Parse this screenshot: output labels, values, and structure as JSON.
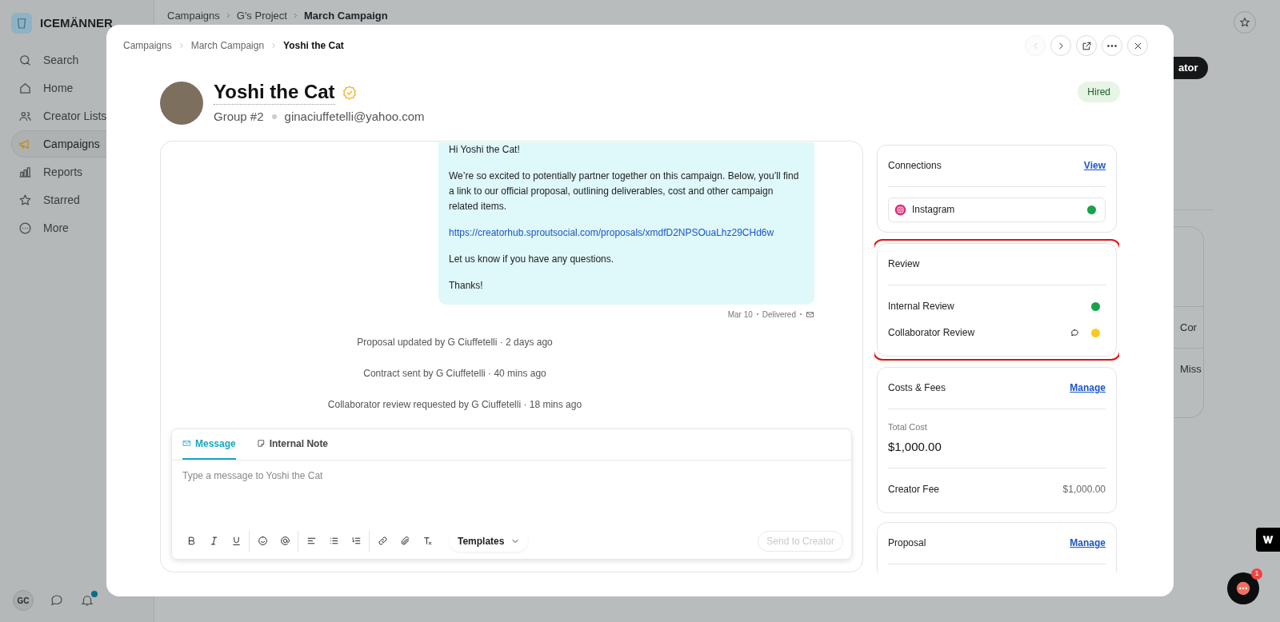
{
  "app": {
    "brand": "ICEMÄNNER",
    "nav": [
      {
        "kind": "search",
        "label": "Search",
        "selected": false
      },
      {
        "kind": "home",
        "label": "Home",
        "selected": false
      },
      {
        "kind": "lists",
        "label": "Creator Lists",
        "selected": false
      },
      {
        "kind": "campaigns",
        "label": "Campaigns",
        "selected": true
      },
      {
        "kind": "reports",
        "label": "Reports",
        "selected": false
      },
      {
        "kind": "starred",
        "label": "Starred",
        "selected": false
      },
      {
        "kind": "more",
        "label": "More",
        "selected": false
      }
    ],
    "user_initials": "GC",
    "notifications_unread": true,
    "breadcrumbs": [
      "Campaigns",
      "G's Project",
      "March Campaign"
    ],
    "partial_button": "ator",
    "partial_texts": [
      "Cor",
      "Miss"
    ],
    "chat_badge": "1"
  },
  "modal": {
    "breadcrumbs": [
      "Campaigns",
      "March Campaign",
      "Yoshi the Cat"
    ],
    "nav_buttons": [
      {
        "kind": "prev",
        "disabled": true
      },
      {
        "kind": "next",
        "disabled": false
      },
      {
        "kind": "open",
        "disabled": false
      },
      {
        "kind": "more",
        "disabled": false
      },
      {
        "kind": "close",
        "disabled": false
      }
    ],
    "creator": {
      "name": "Yoshi the Cat",
      "verified": true,
      "group": "Group #2",
      "email": "ginaciuffetelli@yahoo.com",
      "status": "Hired"
    },
    "message": {
      "paragraphs": [
        {
          "kind": "text",
          "text": "Hi Yoshi the Cat!"
        },
        {
          "kind": "text",
          "text": "We’re so excited to potentially partner together on this campaign. Below, you’ll find a link to our official proposal, outlining deliverables, cost and other campaign related items."
        },
        {
          "kind": "link",
          "text": "https://creatorhub.sproutsocial.com/proposals/xmdfD2NPSOuaLhz29CHd6w"
        },
        {
          "kind": "text",
          "text": "Let us know if you have any questions."
        },
        {
          "kind": "text",
          "text": "Thanks!"
        }
      ],
      "date": "Mar 10",
      "status": "Delivered"
    },
    "events": [
      "Proposal updated by G Ciuffetelli · 2 days ago",
      "Contract sent by G Ciuffetelli · 40 mins ago",
      "Collaborator review requested by G Ciuffetelli · 18 mins ago"
    ],
    "composer": {
      "tabs": [
        {
          "kind": "message",
          "label": "Message",
          "selected": true
        },
        {
          "kind": "note",
          "label": "Internal Note",
          "selected": false
        }
      ],
      "placeholder": "Type a message to Yoshi the Cat",
      "templates": "Templates",
      "send": "Send to Creator",
      "send_disabled": true
    },
    "cards": [
      {
        "kind": "connections",
        "title": "Connections",
        "action": "View",
        "highlighted": false,
        "items": [
          {
            "label": "Instagram",
            "color": "#16a34a"
          }
        ]
      },
      {
        "kind": "review",
        "title": "Review",
        "highlighted": true,
        "items": [
          {
            "label": "Internal Review",
            "color": "#16a34a",
            "comment": false
          },
          {
            "label": "Collaborator Review",
            "color": "#fbc926",
            "comment": true
          }
        ]
      },
      {
        "kind": "costs",
        "title": "Costs & Fees",
        "action": "Manage",
        "highlighted": false,
        "total_label": "Total Cost",
        "total": "$1,000.00",
        "rows": [
          {
            "label": "Creator Fee",
            "value": "$1,000.00"
          }
        ]
      },
      {
        "kind": "proposal",
        "title": "Proposal",
        "action": "Manage",
        "highlighted": false
      }
    ]
  }
}
